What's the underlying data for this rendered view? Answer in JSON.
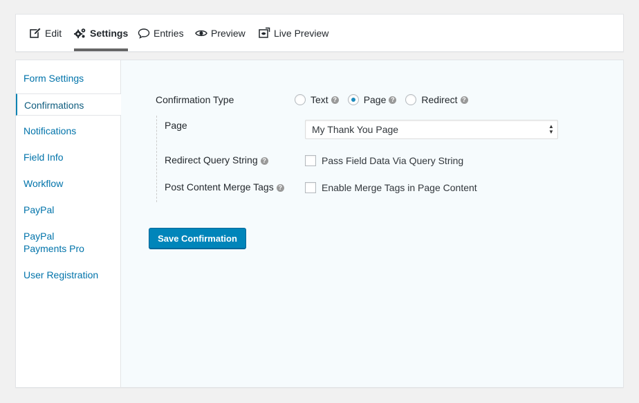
{
  "toolbar": {
    "items": [
      {
        "label": "Edit",
        "icon": "edit-icon"
      },
      {
        "label": "Settings",
        "icon": "gears-icon",
        "active": true
      },
      {
        "label": "Entries",
        "icon": "speech-bubble-icon"
      },
      {
        "label": "Preview",
        "icon": "eye-icon"
      },
      {
        "label": "Live Preview",
        "icon": "live-preview-icon"
      }
    ]
  },
  "sidebar": {
    "items": [
      {
        "label": "Form Settings"
      },
      {
        "label": "Confirmations",
        "active": true
      },
      {
        "label": "Notifications"
      },
      {
        "label": "Field Info"
      },
      {
        "label": "Workflow"
      },
      {
        "label": "PayPal"
      },
      {
        "label": "PayPal Payments Pro"
      },
      {
        "label": "User Registration"
      }
    ]
  },
  "form": {
    "confirmation_type_label": "Confirmation Type",
    "options": [
      {
        "label": "Text",
        "checked": false
      },
      {
        "label": "Page",
        "checked": true
      },
      {
        "label": "Redirect",
        "checked": false
      }
    ],
    "page_label": "Page",
    "page_selected": "My Thank You Page",
    "redirect_query_label": "Redirect Query String",
    "redirect_query_checkbox": "Pass Field Data Via Query String",
    "merge_tags_label": "Post Content Merge Tags",
    "merge_tags_checkbox": "Enable Merge Tags in Page Content",
    "save_button": "Save Confirmation"
  },
  "colors": {
    "link": "#0073aa",
    "primary_button": "#0085ba",
    "panel_bg": "#f6fbfd"
  }
}
